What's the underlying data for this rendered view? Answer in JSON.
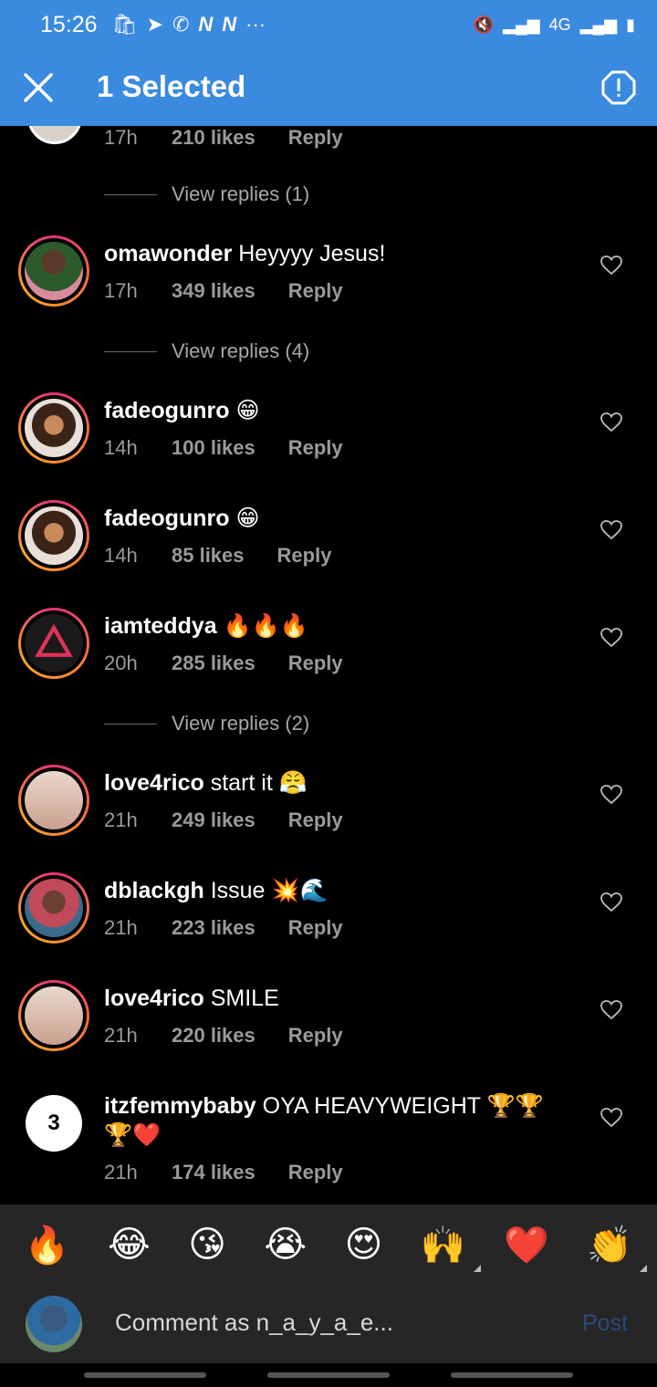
{
  "status_bar": {
    "time": "15:26",
    "left_icons": [
      "shopping-bag-icon",
      "telegram-icon",
      "whatsapp-icon",
      "n-icon",
      "n-icon",
      "more-icon"
    ],
    "right_icons": [
      "mute-icon",
      "signal-icon",
      "4g-icon",
      "signal-icon",
      "battery-icon"
    ],
    "network_label": "4G"
  },
  "action_bar": {
    "title": "1 Selected",
    "accent": "#3a8ae0"
  },
  "partial_comment": {
    "time": "17h",
    "likes": "210 likes",
    "reply": "Reply"
  },
  "comments": [
    {
      "view_replies_before": "View replies (1)"
    },
    {
      "user": "omawonder",
      "text": " Heyyyy Jesus!",
      "time": "17h",
      "likes": "349 likes",
      "reply": "Reply",
      "view_replies_after": "View replies (4)"
    },
    {
      "user": "fadeogunro",
      "text": " 😁",
      "time": "14h",
      "likes": "100 likes",
      "reply": "Reply"
    },
    {
      "user": "fadeogunro",
      "text": " 😁",
      "time": "14h",
      "likes": "85 likes",
      "reply": "Reply"
    },
    {
      "user": "iamteddya",
      "text": " 🔥🔥🔥",
      "time": "20h",
      "likes": "285 likes",
      "reply": "Reply",
      "view_replies_after": "View replies (2)"
    },
    {
      "user": "love4rico",
      "text": " start it 😤",
      "time": "21h",
      "likes": "249 likes",
      "reply": "Reply"
    },
    {
      "user": "dblackgh",
      "text": " Issue 💥🌊",
      "time": "21h",
      "likes": "223 likes",
      "reply": "Reply"
    },
    {
      "user": "love4rico",
      "text": " SMILE",
      "time": "21h",
      "likes": "220 likes",
      "reply": "Reply"
    },
    {
      "user": "itzfemmybaby",
      "text": " OYA HEAVYWEIGHT 🏆🏆 🏆❤️",
      "time": "21h",
      "likes": "174 likes",
      "reply": "Reply"
    }
  ],
  "emoji_bar": [
    "🔥",
    "😂",
    "😘",
    "😭",
    "😍",
    "🙌",
    "❤️",
    "👏"
  ],
  "comment_bar": {
    "placeholder": "Comment as n_a_y_a_e...",
    "post": "Post"
  }
}
